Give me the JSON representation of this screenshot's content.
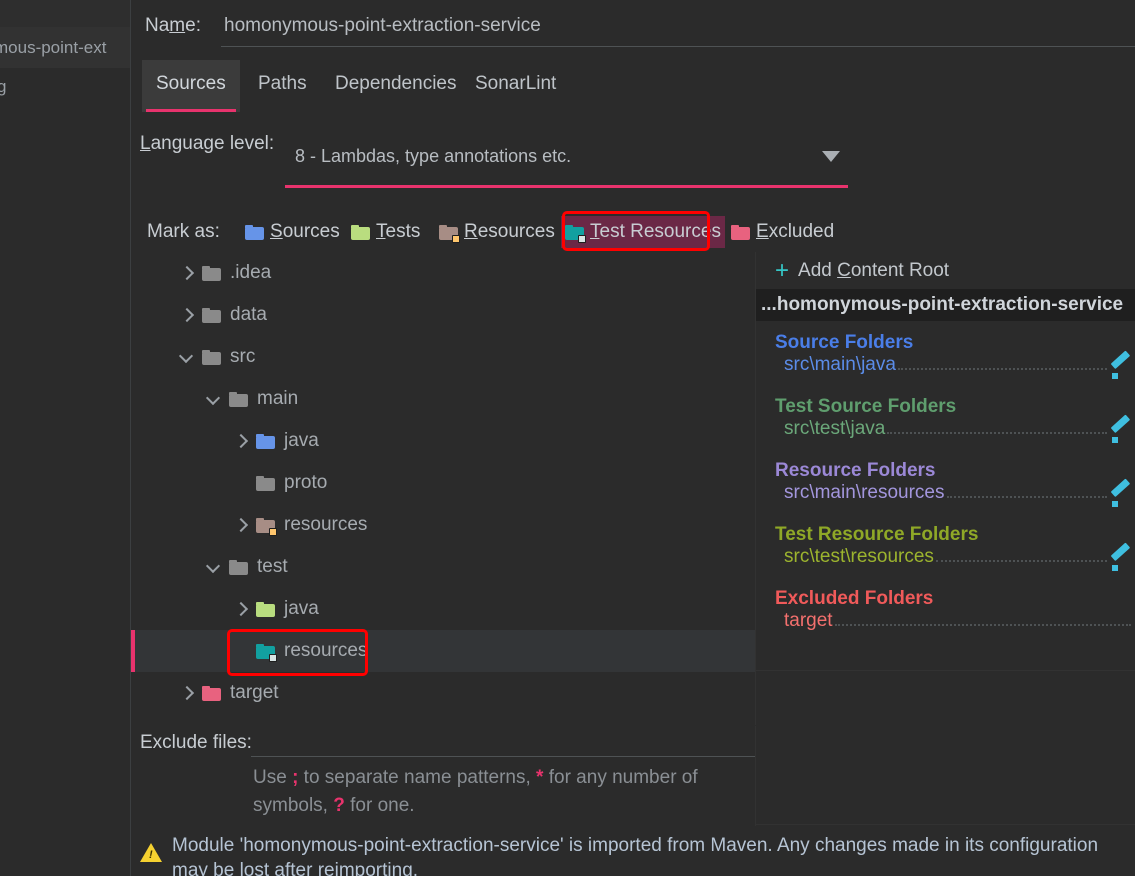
{
  "background_window": {
    "partial_text_top": "mous-point-ext",
    "partial_text_bottom": "g"
  },
  "name_row": {
    "label_pre": "Na",
    "label_accel": "m",
    "label_post": "e:",
    "value": "homonymous-point-extraction-service"
  },
  "tabs": [
    {
      "label": "Sources",
      "active": true
    },
    {
      "label": "Paths",
      "active": false
    },
    {
      "label": "Dependencies",
      "active": false
    },
    {
      "label": "SonarLint",
      "active": false
    }
  ],
  "language_level": {
    "label_pre": "L",
    "label_post": "anguage level:",
    "value": "8 - Lambdas, type annotations etc.",
    "arrow_icon": "chevron-down-icon"
  },
  "mark_as": {
    "label": "Mark as:",
    "buttons": [
      {
        "label_pre": "S",
        "label_post": "ources",
        "icon": "folder-blue-icon",
        "highlighted": false
      },
      {
        "label_pre": "T",
        "label_post": "ests",
        "icon": "folder-green-icon",
        "highlighted": false
      },
      {
        "label_pre": "R",
        "label_post": "esources",
        "icon": "folder-brown-badge-icon",
        "highlighted": false
      },
      {
        "label_pre": "T",
        "label_post": "est Resources",
        "icon": "folder-teal-badge-icon",
        "highlighted": true
      },
      {
        "label_pre": "E",
        "label_post": "xcluded",
        "icon": "folder-pink-icon",
        "highlighted": false
      }
    ]
  },
  "tree": [
    {
      "label": ".idea",
      "depth": 1,
      "chevron": "right",
      "icon": "folder-gray-icon",
      "selected": false
    },
    {
      "label": "data",
      "depth": 1,
      "chevron": "right",
      "icon": "folder-gray-icon",
      "selected": false
    },
    {
      "label": "src",
      "depth": 1,
      "chevron": "down",
      "icon": "folder-gray-icon",
      "selected": false
    },
    {
      "label": "main",
      "depth": 2,
      "chevron": "down",
      "icon": "folder-gray-icon",
      "selected": false
    },
    {
      "label": "java",
      "depth": 3,
      "chevron": "right",
      "icon": "folder-blue-icon",
      "selected": false
    },
    {
      "label": "proto",
      "depth": 3,
      "chevron": "none",
      "icon": "folder-gray-icon",
      "selected": false
    },
    {
      "label": "resources",
      "depth": 3,
      "chevron": "right",
      "icon": "folder-brown-badge-icon",
      "selected": false
    },
    {
      "label": "test",
      "depth": 2,
      "chevron": "down",
      "icon": "folder-gray-icon",
      "selected": false
    },
    {
      "label": "java",
      "depth": 3,
      "chevron": "right",
      "icon": "folder-green-icon",
      "selected": false
    },
    {
      "label": "resources",
      "depth": 3,
      "chevron": "none",
      "icon": "folder-teal-badge-icon",
      "selected": true
    },
    {
      "label": "target",
      "depth": 1,
      "chevron": "right",
      "icon": "folder-pink-icon",
      "selected": false
    }
  ],
  "content_roots": {
    "add_label_pre": "Add ",
    "add_label_accel": "C",
    "add_label_post": "ontent Root",
    "add_icon": "plus-icon",
    "root_title": "...homonymous-point-extraction-service",
    "groups": [
      {
        "heading": "Source Folders",
        "items": [
          {
            "path": "src\\main\\java",
            "edit_icon": "pencil-icon"
          }
        ]
      },
      {
        "heading": "Test Source Folders",
        "items": [
          {
            "path": "src\\test\\java",
            "edit_icon": "pencil-icon"
          }
        ]
      },
      {
        "heading": "Resource Folders",
        "items": [
          {
            "path": "src\\main\\resources",
            "edit_icon": "pencil-icon"
          }
        ]
      },
      {
        "heading": "Test Resource Folders",
        "items": [
          {
            "path": "src\\test\\resources",
            "edit_icon": "pencil-icon"
          }
        ]
      },
      {
        "heading": "Excluded Folders",
        "items": [
          {
            "path": "target",
            "edit_icon": ""
          }
        ]
      }
    ]
  },
  "exclude_files": {
    "label": "Exclude files:",
    "value": "",
    "hint_1": "Use ",
    "hint_sep": ";",
    "hint_2": " to separate name patterns, ",
    "hint_star": "*",
    "hint_3": " for any number of symbols, ",
    "hint_q": "?",
    "hint_4": " for one."
  },
  "warning": {
    "icon": "warning-triangle-icon",
    "line1": "Module 'homonymous-point-extraction-service' is imported from Maven. Any changes made in its configuration",
    "line2": "may be lost after reimporting."
  },
  "colors": {
    "accent_pink": "#e8336d",
    "annotation_red": "#ff0000",
    "highlight_bg": "#6b2846",
    "panel_bg": "#2b2b2b",
    "selected_row": "#333537",
    "link_cyan": "#35c6c6"
  }
}
